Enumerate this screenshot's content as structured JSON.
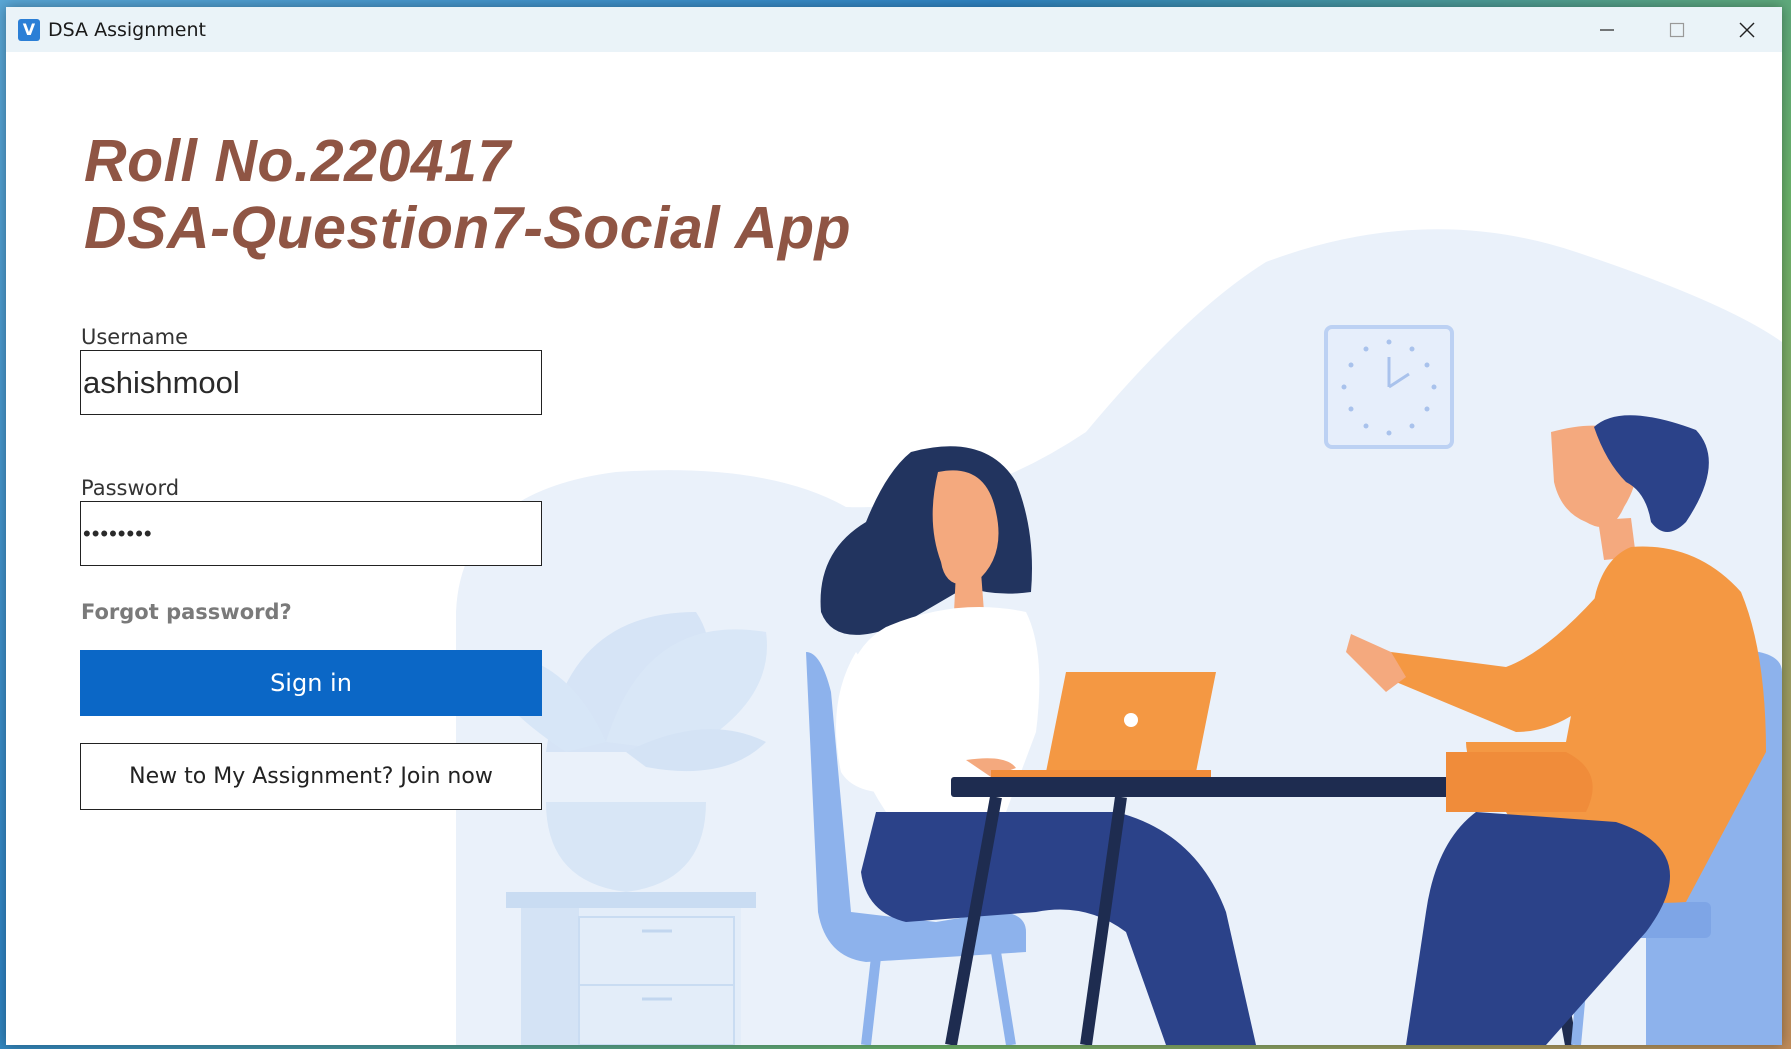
{
  "window": {
    "app_icon_letter": "V",
    "title": "DSA Assignment"
  },
  "heading": {
    "line1": "Roll No.220417",
    "line2": "DSA-Question7-Social App"
  },
  "form": {
    "username_label": "Username",
    "username_value": "ashishmool",
    "password_label": "Password",
    "password_value": "••••••••",
    "forgot_label": "Forgot password?",
    "signin_label": "Sign in",
    "join_label": "New to My Assignment? Join now"
  },
  "colors": {
    "heading": "#8f5544",
    "primary_button": "#0b67c6",
    "titlebar": "#eaf3f8"
  },
  "icons": {
    "app": "app-v-icon",
    "minimize": "minimize-icon",
    "maximize": "maximize-icon",
    "close": "close-icon"
  }
}
